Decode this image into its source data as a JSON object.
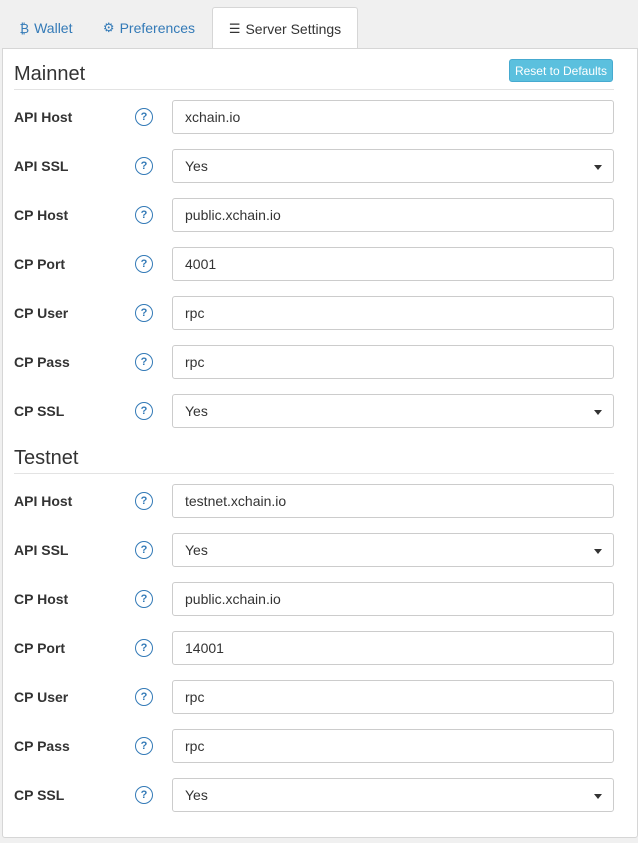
{
  "tabs": [
    {
      "label": "Wallet",
      "icon": "bitcoin-icon",
      "glyph": "₿"
    },
    {
      "label": "Preferences",
      "icon": "gear-icon",
      "glyph": "⚙"
    },
    {
      "label": "Server Settings",
      "icon": "server-list-icon",
      "glyph": "☰"
    }
  ],
  "reset_button": "Reset to Defaults",
  "help_glyph": "?",
  "mainnet": {
    "title": "Mainnet",
    "fields": [
      {
        "label": "API Host",
        "value": "xchain.io",
        "type": "text"
      },
      {
        "label": "API SSL",
        "value": "Yes",
        "type": "select"
      },
      {
        "label": "CP Host",
        "value": "public.xchain.io",
        "type": "text"
      },
      {
        "label": "CP Port",
        "value": "4001",
        "type": "text"
      },
      {
        "label": "CP User",
        "value": "rpc",
        "type": "text"
      },
      {
        "label": "CP Pass",
        "value": "rpc",
        "type": "text"
      },
      {
        "label": "CP SSL",
        "value": "Yes",
        "type": "select"
      }
    ]
  },
  "testnet": {
    "title": "Testnet",
    "fields": [
      {
        "label": "API Host",
        "value": "testnet.xchain.io",
        "type": "text"
      },
      {
        "label": "API SSL",
        "value": "Yes",
        "type": "select"
      },
      {
        "label": "CP Host",
        "value": "public.xchain.io",
        "type": "text"
      },
      {
        "label": "CP Port",
        "value": "14001",
        "type": "text"
      },
      {
        "label": "CP User",
        "value": "rpc",
        "type": "text"
      },
      {
        "label": "CP Pass",
        "value": "rpc",
        "type": "text"
      },
      {
        "label": "CP SSL",
        "value": "Yes",
        "type": "select"
      }
    ]
  },
  "colors": {
    "link": "#337ab7",
    "reset_button": "#5bc0de"
  }
}
